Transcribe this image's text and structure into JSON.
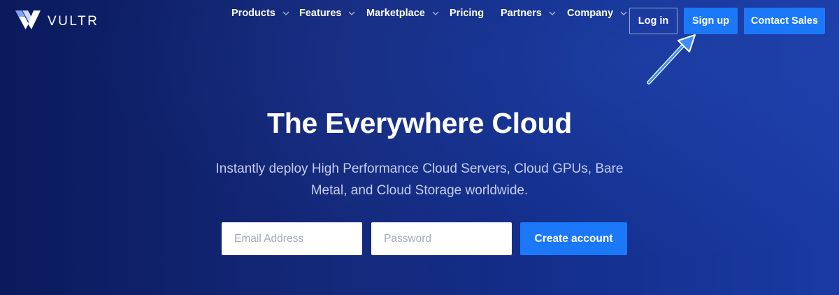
{
  "brand": {
    "name": "VULTR",
    "logo_icon": "vultr-v-logo-icon"
  },
  "nav": {
    "items": [
      {
        "label": "Products",
        "dropdown": true
      },
      {
        "label": "Features",
        "dropdown": true
      },
      {
        "label": "Marketplace",
        "dropdown": true
      },
      {
        "label": "Pricing",
        "dropdown": false
      },
      {
        "label": "Partners",
        "dropdown": true
      },
      {
        "label": "Company",
        "dropdown": true
      }
    ],
    "chevron_icon": "chevron-down-icon"
  },
  "header_buttons": {
    "login_label": "Log in",
    "signup_label": "Sign up",
    "contact_label": "Contact Sales"
  },
  "hero": {
    "title": "The Everywhere Cloud",
    "subtitle": "Instantly deploy High Performance Cloud Servers, Cloud GPUs, Bare Metal, and Cloud Storage worldwide."
  },
  "signup_form": {
    "email_placeholder": "Email Address",
    "password_placeholder": "Password",
    "email_value": "",
    "password_value": "",
    "submit_label": "Create account"
  },
  "annotation": {
    "icon": "arrow-pointer-icon",
    "target": "Sign up"
  },
  "colors": {
    "background_dark": "#0b1a5c",
    "background_light": "#1a3aa3",
    "accent_blue": "#1b78f8",
    "subtitle_text": "#c5cdf0",
    "white": "#ffffff"
  }
}
